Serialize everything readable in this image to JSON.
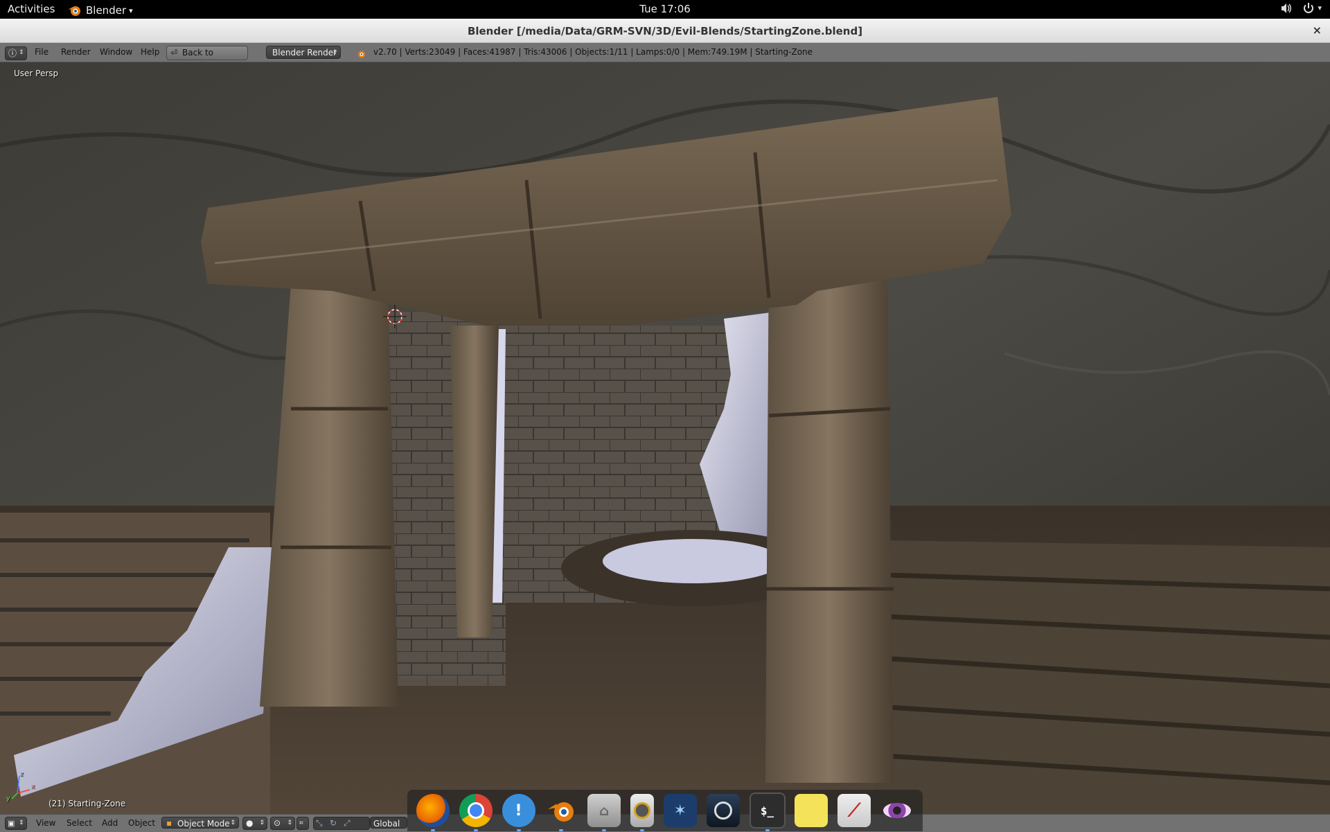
{
  "topbar": {
    "activities": "Activities",
    "app_name": "Blender",
    "app_dropdown": "▾",
    "clock": "Tue 17:06",
    "volume_icon": "speaker-icon",
    "power_icon": "power-icon"
  },
  "window": {
    "title": "Blender [/media/Data/GRM-SVN/3D/Evil-Blends/StartingZone.blend]",
    "close": "×"
  },
  "info_header": {
    "menus": [
      "File",
      "Render",
      "Window",
      "Help"
    ],
    "back_button": "Back to Previous",
    "render_engine": "Blender Render",
    "stats": "v2.70 | Verts:23049 | Faces:41987 | Tris:43006 | Objects:1/11 | Lamps:0/0 | Mem:749.19M | Starting-Zone"
  },
  "viewport": {
    "view_label": "User Persp",
    "object_label": "(21) Starting-Zone",
    "axis_x": "x",
    "axis_y": "y",
    "axis_z": "z"
  },
  "view3d_header": {
    "menus": [
      "View",
      "Select",
      "Add",
      "Object"
    ],
    "mode": "Object Mode",
    "orientation": "Global"
  },
  "dock": {
    "apps": [
      {
        "name": "Firefox",
        "icon": "firefox-icon",
        "color": "#e66000"
      },
      {
        "name": "Chrome",
        "icon": "chrome-icon",
        "color": "#4285f4"
      },
      {
        "name": "Notifications",
        "icon": "exclamation-icon",
        "color": "#3a8fdc"
      },
      {
        "name": "Blender",
        "icon": "blender-icon",
        "color": "#e87d0d"
      },
      {
        "name": "Files",
        "icon": "home-folder-icon",
        "color": "#9a9a9a"
      },
      {
        "name": "Speaker",
        "icon": "speaker-app-icon",
        "color": "#c8c8c8"
      },
      {
        "name": "StarCraft II",
        "icon": "starcraft-icon",
        "color": "#1c3d6b"
      },
      {
        "name": "Steam",
        "icon": "steam-icon",
        "color": "#1b2838"
      },
      {
        "name": "Terminal",
        "icon": "terminal-icon",
        "color": "#2d2d2d",
        "glyph": "$_"
      },
      {
        "name": "Notes",
        "icon": "sticky-note-icon",
        "color": "#f4e35a"
      },
      {
        "name": "Document Viewer",
        "icon": "pdf-icon",
        "color": "#c62828"
      },
      {
        "name": "Eye of GNOME",
        "icon": "eye-icon",
        "color": "#8e44ad"
      }
    ]
  }
}
